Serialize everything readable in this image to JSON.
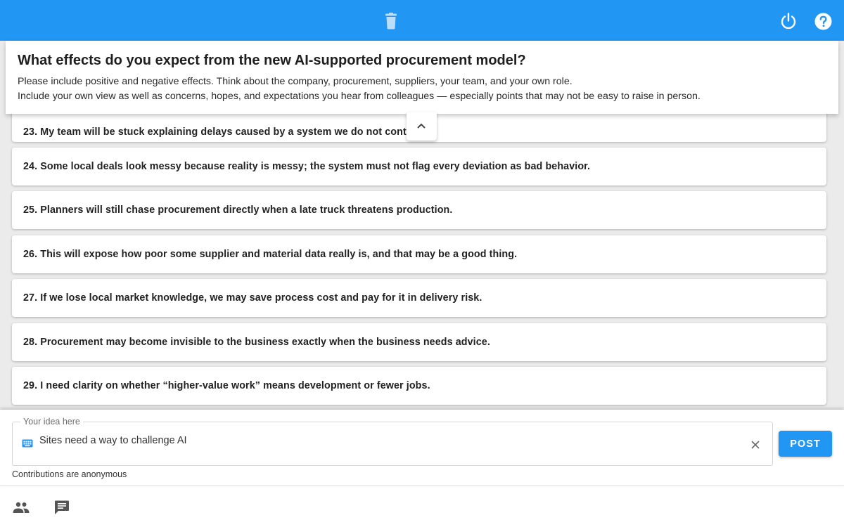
{
  "header": {
    "icons": [
      "trash-icon",
      "power-icon",
      "help-icon"
    ],
    "color": "#2196f3"
  },
  "question": {
    "title": "What effects do you expect from the new AI-supported procurement model?",
    "line1": "Please include positive and negative effects. Think about the company, procurement, suppliers, your team, and your own role.",
    "line2": "Include your own view as well as concerns, hopes, and expectations you hear from colleagues — especially points that may not be easy to raise in person."
  },
  "ideas": [
    "23. My team will be stuck explaining delays caused by a system we do not control.",
    "24. Some local deals look messy because reality is messy; the system must not flag every deviation as bad behavior.",
    "25. Planners will still chase procurement directly when a late truck threatens production.",
    "26. This will expose how poor some supplier and material data really is, and that may be a good thing.",
    "27. If we lose local market knowledge, we may save process cost and pay for it in delivery risk.",
    "28. Procurement may become invisible to the business exactly when the business needs advice.",
    "29. I need clarity on whether “higher-value work” means development or fewer jobs."
  ],
  "composer": {
    "legend": "Your idea here",
    "value": "Sites need a way to challenge AI",
    "post_label": "POST",
    "note": "Contributions are anonymous"
  },
  "bottom_nav": {
    "icons": [
      "people-icon",
      "chat-icon"
    ]
  }
}
